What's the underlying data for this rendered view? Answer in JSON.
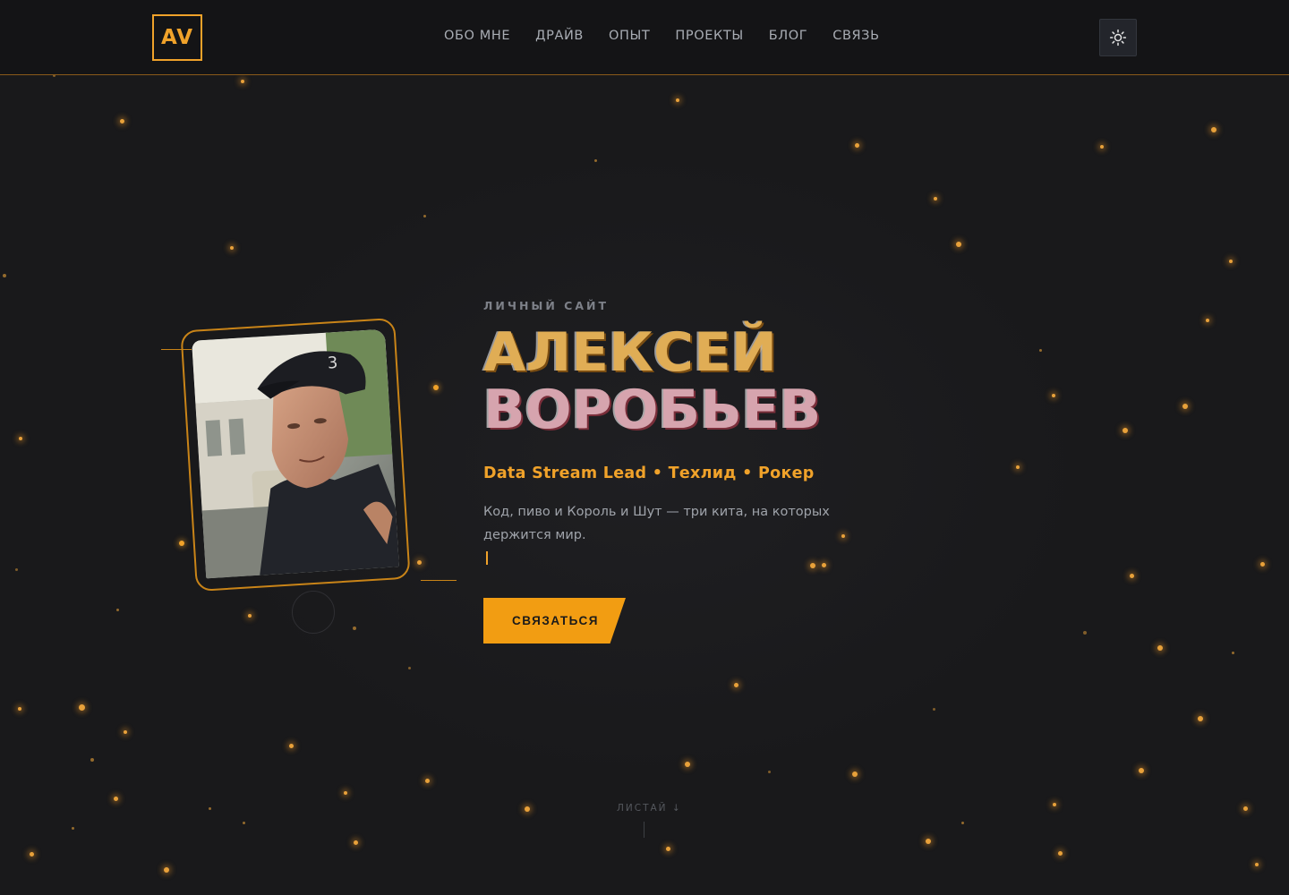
{
  "header": {
    "logo": "AV",
    "nav": [
      "ОБО МНЕ",
      "ДРАЙВ",
      "ОПЫТ",
      "ПРОЕКТЫ",
      "БЛОГ",
      "СВЯЗЬ"
    ],
    "theme_toggle_icon": "sun-icon"
  },
  "hero": {
    "eyebrow": "ЛИЧНЫЙ САЙТ",
    "name_line1": "АЛЕКСЕЙ",
    "name_line2": "ВОРОБЬЕВ",
    "tagline": "Data Stream Lead • Техлид • Рокер",
    "description": "Код, пиво и Король и Шут — три кита, на которых держится мир.",
    "cta_label": "СВЯЗАТЬСЯ",
    "photo_icon": "portrait-photo"
  },
  "scroll_hint": "ЛИСТАЙ ↓",
  "colors": {
    "accent": "#f29d12",
    "background": "#19191b",
    "name_gold": "#e0ad55",
    "name_pink": "#d6a4ae"
  }
}
